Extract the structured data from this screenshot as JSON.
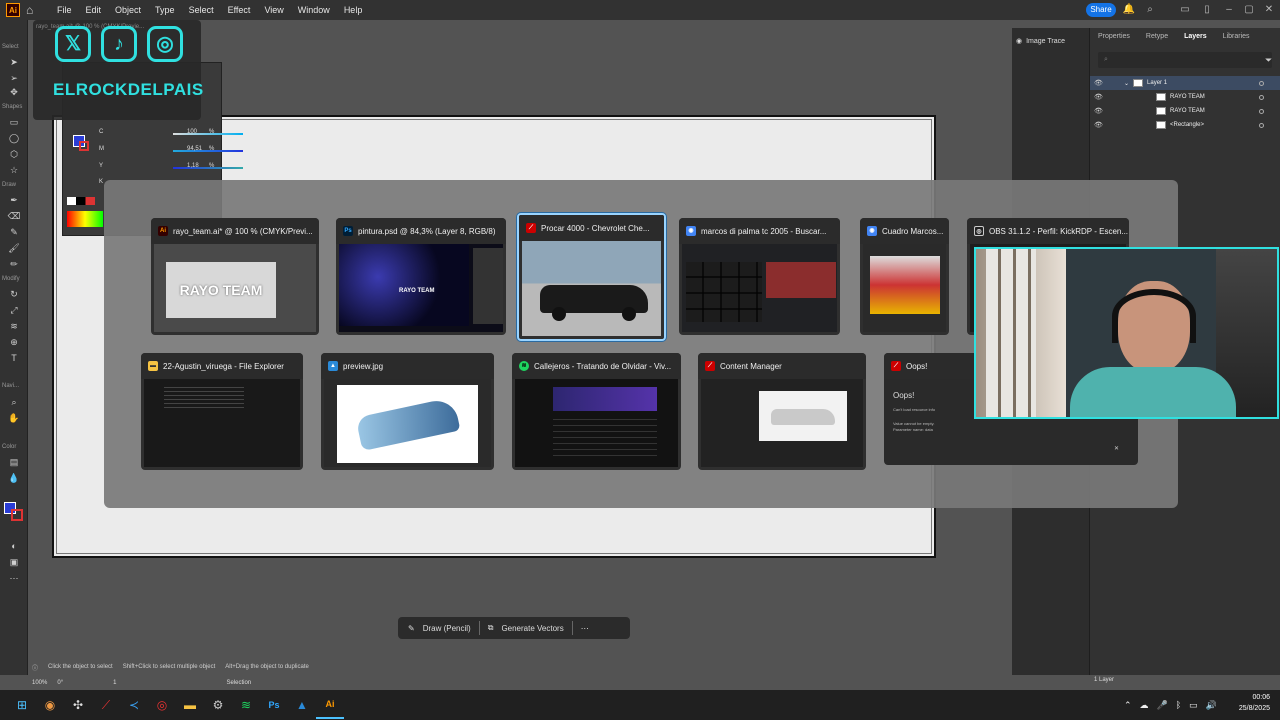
{
  "app": {
    "logo": "Ai",
    "menu": [
      "File",
      "Edit",
      "Object",
      "Type",
      "Select",
      "Effect",
      "View",
      "Window",
      "Help"
    ],
    "share_label": "Share",
    "doc_tab_title": "rayo_team.ai* @ 100 % (CMYK/Previ..."
  },
  "toolbar": {
    "labels": [
      "Select",
      "Shapes",
      "Draw",
      "Modify",
      "Navi...",
      "Color"
    ]
  },
  "right_panel": {
    "image_trace_label": "Image Trace",
    "tabs": [
      "Properties",
      "Retype",
      "Layers",
      "Libraries"
    ],
    "active_tab": "Layers",
    "layers": [
      {
        "name": "Layer 1",
        "level": 0,
        "selected": true
      },
      {
        "name": "RAYO TEAM",
        "level": 1,
        "selected": false
      },
      {
        "name": "RAYO TEAM",
        "level": 1,
        "selected": false
      },
      {
        "name": "<Rectangle>",
        "level": 1,
        "selected": false
      }
    ],
    "layers_count": "1 Layer"
  },
  "color_panel": {
    "c_label": "C",
    "m_label": "M",
    "y_label": "Y",
    "k_label": "K",
    "c_value": "100",
    "m_value": "94,51",
    "y_value": "1,18",
    "pct": "%"
  },
  "social_overlay": {
    "handle": "ELROCKDELPAIS",
    "icons": [
      "x-icon",
      "tiktok-icon",
      "instagram-icon"
    ],
    "faded_tab": "rayo_team.ai* @ 100 % (CMYK/Previe..."
  },
  "context_bar": {
    "draw_label": "Draw (Pencil)",
    "generate_label": "Generate Vectors"
  },
  "status": {
    "hint1": "Click the object to select",
    "hint2": "Shift+Click to select multiple object",
    "hint3": "Alt+Drag the object to duplicate",
    "zoom": "100%",
    "rotation": "0°",
    "page": "1",
    "mode": "Selection"
  },
  "switcher": {
    "row1": [
      {
        "title": "rayo_team.ai* @ 100 % (CMYK/Previ...",
        "app": "Ai",
        "color": "#ff9a00",
        "bg": "#330000",
        "preview_text": "RAYO TEAM"
      },
      {
        "title": "pintura.psd @ 84,3% (Layer 8, RGB/8)",
        "app": "Ps",
        "color": "#31a8ff",
        "bg": "#001e36",
        "preview_text": "RAYO TEAM"
      },
      {
        "title": "Procar 4000 - Chevrolet Che...",
        "app": "AC",
        "color": "#fff",
        "bg": "#c00",
        "active": true
      },
      {
        "title": "marcos di palma tc 2005 - Buscar...",
        "app": "G",
        "color": "#fff",
        "bg": "#4285f4"
      },
      {
        "title": "Cuadro Marcos...",
        "app": "G",
        "color": "#fff",
        "bg": "#4285f4"
      },
      {
        "title": "OBS 31.1.2 - Perfil: KickRDP - Escen...",
        "app": "O",
        "color": "#fff",
        "bg": "#222"
      }
    ],
    "row2": [
      {
        "title": "22-Agustin_viruega - File Explorer",
        "app": "F",
        "color": "#333",
        "bg": "#f6c343"
      },
      {
        "title": "preview.jpg",
        "app": "P",
        "color": "#fff",
        "bg": "#2a8ad8"
      },
      {
        "title": "Callejeros - Tratando de Olvidar - Viv...",
        "app": "S",
        "color": "#000",
        "bg": "#1ed760"
      },
      {
        "title": "Content Manager",
        "app": "C",
        "color": "#fff",
        "bg": "#c00"
      },
      {
        "title": "Oops!",
        "app": "!",
        "color": "#fff",
        "bg": "#c00"
      }
    ],
    "oops": {
      "heading": "Oops!",
      "line1": "Can't load resource info",
      "line2": "Value cannot be empty.",
      "line3": "Parameter name: data"
    }
  },
  "taskbar": {
    "date": "25/8/2025",
    "time": "00:06",
    "apps": [
      "windows-start-icon",
      "chrome-icon",
      "app-icon",
      "content-manager-icon",
      "vscode-icon",
      "obs-icon",
      "file-explorer-icon",
      "steam-icon",
      "spotify-icon",
      "photoshop-icon",
      "photos-icon",
      "illustrator-icon"
    ]
  }
}
